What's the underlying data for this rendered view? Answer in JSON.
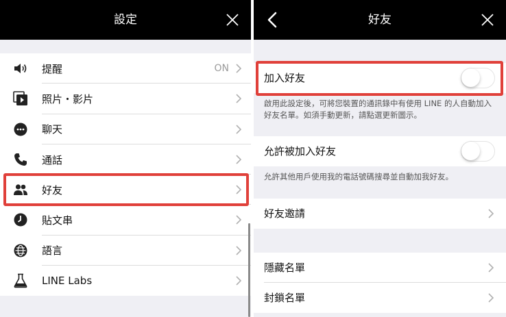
{
  "left_panel": {
    "title": "設定",
    "items": [
      {
        "label": "提醒",
        "value": "ON",
        "icon": "speaker-icon"
      },
      {
        "label": "照片・影片",
        "value": "",
        "icon": "media-icon"
      },
      {
        "label": "聊天",
        "value": "",
        "icon": "chat-bubble-icon"
      },
      {
        "label": "通話",
        "value": "",
        "icon": "phone-icon"
      },
      {
        "label": "好友",
        "value": "",
        "icon": "friends-icon"
      },
      {
        "label": "貼文串",
        "value": "",
        "icon": "clock-icon"
      },
      {
        "label": "語言",
        "value": "",
        "icon": "globe-icon"
      },
      {
        "label": "LINE Labs",
        "value": "",
        "icon": "flask-icon"
      }
    ]
  },
  "right_panel": {
    "title": "好友",
    "auto_add": {
      "label": "加入好友",
      "on": false
    },
    "auto_add_note": "啟用此設定後，可將您裝置的通訊錄中有使用 LINE 的人自動加入好友名單。如須手動更新，請點選更新圖示。",
    "allow_add": {
      "label": "允許被加入好友",
      "on": false
    },
    "allow_add_note": "允許其他用戶使用我的電話號碼搜尋並自動加我好友。",
    "invite": {
      "label": "好友邀請"
    },
    "hidden": {
      "label": "隱藏名單"
    },
    "blocked": {
      "label": "封鎖名單"
    }
  },
  "colors": {
    "highlight": "#e0403a",
    "topbar": "#000000",
    "background": "#efeff4"
  }
}
